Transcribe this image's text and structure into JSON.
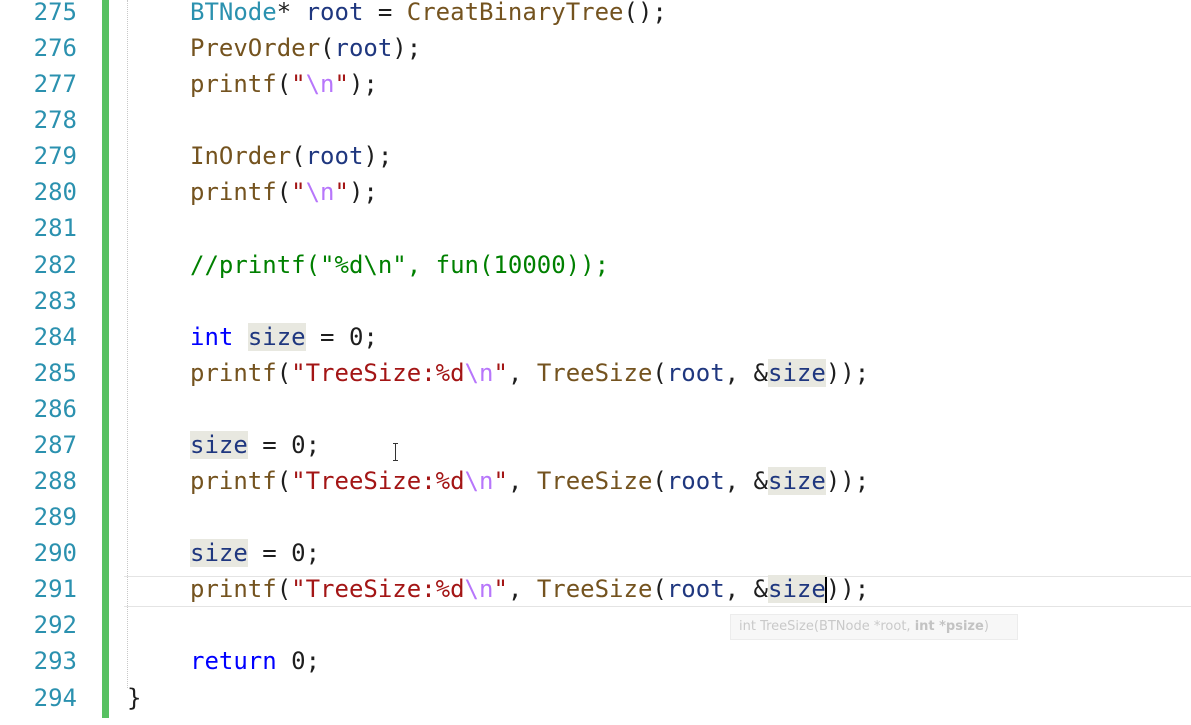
{
  "lines": [
    {
      "num": "275",
      "tokens": [
        {
          "t": "BTNode",
          "c": "type"
        },
        {
          "t": "* ",
          "c": ""
        },
        {
          "t": "root",
          "c": "var"
        },
        {
          "t": " = ",
          "c": ""
        },
        {
          "t": "CreatBinaryTree",
          "c": "fn"
        },
        {
          "t": "();",
          "c": ""
        }
      ]
    },
    {
      "num": "276",
      "tokens": [
        {
          "t": "PrevOrder",
          "c": "fn"
        },
        {
          "t": "(",
          "c": ""
        },
        {
          "t": "root",
          "c": "var"
        },
        {
          "t": ");",
          "c": ""
        }
      ]
    },
    {
      "num": "277",
      "tokens": [
        {
          "t": "printf",
          "c": "fn"
        },
        {
          "t": "(",
          "c": ""
        },
        {
          "t": "\"",
          "c": "str"
        },
        {
          "t": "\\n",
          "c": "esc"
        },
        {
          "t": "\"",
          "c": "str"
        },
        {
          "t": ");",
          "c": ""
        }
      ]
    },
    {
      "num": "278",
      "tokens": []
    },
    {
      "num": "279",
      "tokens": [
        {
          "t": "InOrder",
          "c": "fn"
        },
        {
          "t": "(",
          "c": ""
        },
        {
          "t": "root",
          "c": "var"
        },
        {
          "t": ");",
          "c": ""
        }
      ]
    },
    {
      "num": "280",
      "tokens": [
        {
          "t": "printf",
          "c": "fn"
        },
        {
          "t": "(",
          "c": ""
        },
        {
          "t": "\"",
          "c": "str"
        },
        {
          "t": "\\n",
          "c": "esc"
        },
        {
          "t": "\"",
          "c": "str"
        },
        {
          "t": ");",
          "c": ""
        }
      ]
    },
    {
      "num": "281",
      "tokens": []
    },
    {
      "num": "282",
      "tokens": [
        {
          "t": "//printf(\"%d\\n\", fun(10000));",
          "c": "cmt"
        }
      ]
    },
    {
      "num": "283",
      "tokens": []
    },
    {
      "num": "284",
      "tokens": [
        {
          "t": "int",
          "c": "kw"
        },
        {
          "t": " ",
          "c": ""
        },
        {
          "t": "size",
          "c": "var hl"
        },
        {
          "t": " = ",
          "c": ""
        },
        {
          "t": "0",
          "c": "num"
        },
        {
          "t": ";",
          "c": ""
        }
      ]
    },
    {
      "num": "285",
      "tokens": [
        {
          "t": "printf",
          "c": "fn"
        },
        {
          "t": "(",
          "c": ""
        },
        {
          "t": "\"TreeSize:%d",
          "c": "str"
        },
        {
          "t": "\\n",
          "c": "esc"
        },
        {
          "t": "\"",
          "c": "str"
        },
        {
          "t": ", ",
          "c": ""
        },
        {
          "t": "TreeSize",
          "c": "fn"
        },
        {
          "t": "(",
          "c": ""
        },
        {
          "t": "root",
          "c": "var"
        },
        {
          "t": ", &",
          "c": ""
        },
        {
          "t": "size",
          "c": "var hl"
        },
        {
          "t": "));",
          "c": ""
        }
      ]
    },
    {
      "num": "286",
      "tokens": []
    },
    {
      "num": "287",
      "tokens": [
        {
          "t": "size",
          "c": "var hl"
        },
        {
          "t": " = ",
          "c": ""
        },
        {
          "t": "0",
          "c": "num"
        },
        {
          "t": ";",
          "c": ""
        }
      ]
    },
    {
      "num": "288",
      "tokens": [
        {
          "t": "printf",
          "c": "fn"
        },
        {
          "t": "(",
          "c": ""
        },
        {
          "t": "\"TreeSize:%d",
          "c": "str"
        },
        {
          "t": "\\n",
          "c": "esc"
        },
        {
          "t": "\"",
          "c": "str"
        },
        {
          "t": ", ",
          "c": ""
        },
        {
          "t": "TreeSize",
          "c": "fn"
        },
        {
          "t": "(",
          "c": ""
        },
        {
          "t": "root",
          "c": "var"
        },
        {
          "t": ", &",
          "c": ""
        },
        {
          "t": "size",
          "c": "var hl"
        },
        {
          "t": "));",
          "c": ""
        }
      ]
    },
    {
      "num": "289",
      "tokens": []
    },
    {
      "num": "290",
      "tokens": [
        {
          "t": "size",
          "c": "var hl"
        },
        {
          "t": " = ",
          "c": ""
        },
        {
          "t": "0",
          "c": "num"
        },
        {
          "t": ";",
          "c": ""
        }
      ]
    },
    {
      "num": "291",
      "tokens": [
        {
          "t": "printf",
          "c": "fn"
        },
        {
          "t": "(",
          "c": ""
        },
        {
          "t": "\"TreeSize:%d",
          "c": "str"
        },
        {
          "t": "\\n",
          "c": "esc"
        },
        {
          "t": "\"",
          "c": "str"
        },
        {
          "t": ", ",
          "c": ""
        },
        {
          "t": "TreeSize",
          "c": "fn"
        },
        {
          "t": "(",
          "c": ""
        },
        {
          "t": "root",
          "c": "var"
        },
        {
          "t": ", &",
          "c": ""
        },
        {
          "t": "size",
          "c": "var hl"
        },
        {
          "t": "|",
          "c": "caret"
        },
        {
          "t": "));",
          "c": ""
        }
      ]
    },
    {
      "num": "292",
      "tokens": []
    },
    {
      "num": "293",
      "tokens": [
        {
          "t": "return",
          "c": "kw"
        },
        {
          "t": " ",
          "c": ""
        },
        {
          "t": "0",
          "c": "num"
        },
        {
          "t": ";",
          "c": ""
        }
      ]
    },
    {
      "num": "294",
      "tokens": [
        {
          "t": "}",
          "c": "brace"
        }
      ]
    }
  ],
  "tooltip": {
    "return_type": "int",
    "function": "TreeSize(",
    "param1": "BTNode *root, ",
    "param2": "int *psize",
    "close": ")"
  },
  "colors": {
    "change_bar": "#57c161",
    "line_number": "#2b91af",
    "keyword": "#0000ff",
    "string": "#a31515",
    "function": "#74531f",
    "variable": "#1f377f",
    "comment": "#008000"
  },
  "icons": {
    "cursor": "text-ibeam-cursor-icon"
  }
}
